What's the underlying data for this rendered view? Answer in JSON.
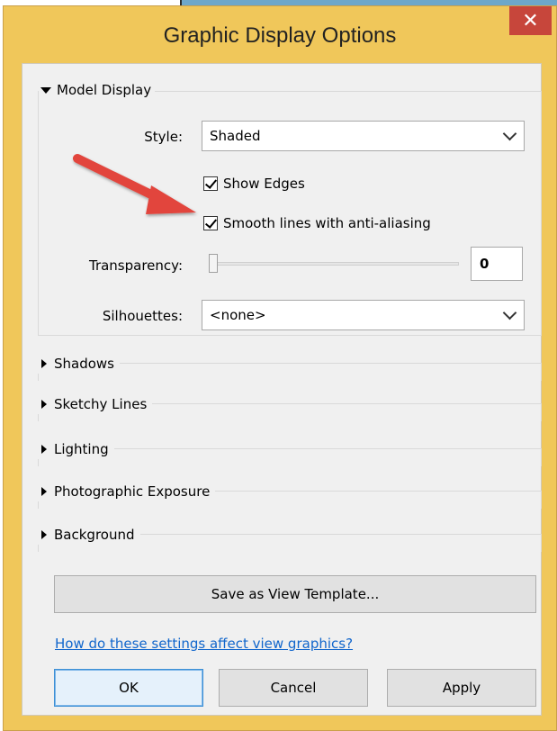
{
  "dialog": {
    "title": "Graphic Display Options",
    "close_glyph": "✕"
  },
  "model_display": {
    "header": "Model Display",
    "style_label": "Style:",
    "style_value": "Shaded",
    "show_edges_label": "Show Edges",
    "show_edges_checked": true,
    "smooth_lines_label": "Smooth lines with anti-aliasing",
    "smooth_lines_checked": true,
    "transparency_label": "Transparency:",
    "transparency_value": "0",
    "silhouettes_label": "Silhouettes:",
    "silhouettes_value": "<none>"
  },
  "sections": [
    {
      "label": "Shadows"
    },
    {
      "label": "Sketchy Lines"
    },
    {
      "label": "Lighting"
    },
    {
      "label": "Photographic Exposure"
    },
    {
      "label": "Background"
    }
  ],
  "save_template_label": "Save as View Template...",
  "help_link": "How do these settings affect view graphics?",
  "buttons": {
    "ok": "OK",
    "cancel": "Cancel",
    "apply": "Apply"
  },
  "colors": {
    "title_bar": "#f0c75a",
    "close_button": "#c7463b",
    "arrow": "#e2453c",
    "link": "#1166cc"
  }
}
